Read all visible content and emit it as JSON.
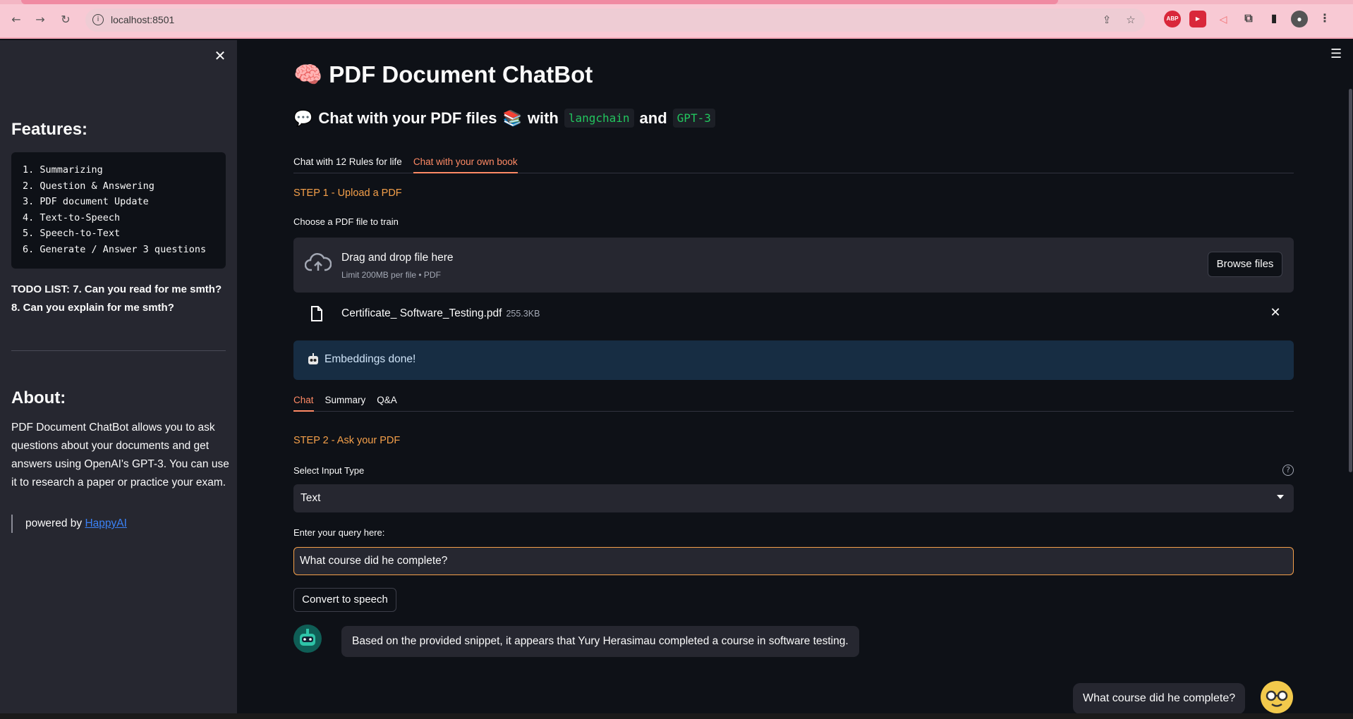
{
  "browser": {
    "url": "localhost:8501",
    "ext_abp": "ABP"
  },
  "sidebar": {
    "features_heading": "Features:",
    "features_list": "1. Summarizing\n2. Question & Answering\n3. PDF document Update\n4. Text-to-Speech\n5. Speech-to-Text\n6. Generate / Answer 3 questions",
    "todo": "TODO LIST: 7. Can you read for me smth? 8. Can you explain for me smth?",
    "about_heading": "About:",
    "about_text": "PDF Document ChatBot allows you to ask questions about your documents and get answers using OpenAI's GPT-3. You can use it to research a paper or practice your exam.",
    "powered_prefix": "powered by ",
    "powered_link": "HappyAI"
  },
  "main": {
    "title_emoji": "🧠",
    "title": "PDF Document ChatBot",
    "subtitle_emoji1": "💬",
    "subtitle_part1": "Chat with your PDF files",
    "subtitle_emoji2": "📚",
    "subtitle_part2": "with",
    "subtitle_code1": "langchain",
    "subtitle_part3": "and",
    "subtitle_code2": "GPT-3",
    "tabs": [
      {
        "label": "Chat with 12 Rules for life",
        "active": false
      },
      {
        "label": "Chat with your own book",
        "active": true
      }
    ],
    "step1": "STEP 1 - Upload a PDF",
    "uploader_label": "Choose a PDF file to train",
    "dropzone_title": "Drag and drop file here",
    "dropzone_sub": "Limit 200MB per file • PDF",
    "browse_label": "Browse files",
    "file_name": "Certificate_ Software_Testing.pdf",
    "file_size": "255.3KB",
    "info_text": "Embeddings done!",
    "sub_tabs": [
      {
        "label": "Chat",
        "active": true
      },
      {
        "label": "Summary",
        "active": false
      },
      {
        "label": "Q&A",
        "active": false
      }
    ],
    "step2": "STEP 2 - Ask your PDF",
    "select_label": "Select Input Type",
    "select_value": "Text",
    "query_label": "Enter your query here:",
    "query_value": "What course did he complete?",
    "speech_button": "Convert to speech",
    "bot_message": "Based on the provided snippet, it appears that Yury Herasimau completed a course in software testing.",
    "user_message": "What course did he complete?"
  },
  "colors": {
    "accent": "#f5a04a",
    "active_tab": "#ff8a65",
    "info_bg": "#172d43",
    "code_green": "#22c55e"
  }
}
